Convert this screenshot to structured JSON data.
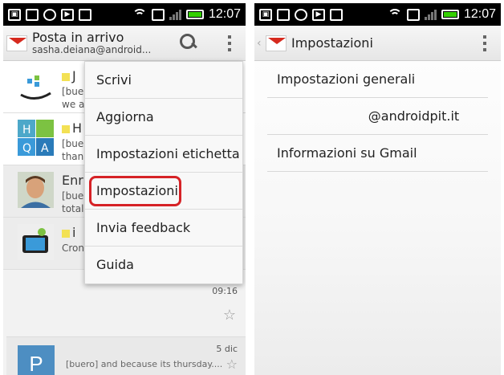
{
  "status_bar": {
    "time": "12:07",
    "icons_left": [
      "picture-icon",
      "bag-icon",
      "chrome-icon",
      "play-store-icon",
      "bag-icon"
    ],
    "icons_right": [
      "wifi-icon",
      "vibrate-icon",
      "signal-icon",
      "battery-icon"
    ]
  },
  "left": {
    "action_bar": {
      "title": "Posta in arrivo",
      "account": "sasha.deiana@android..."
    },
    "overflow_menu": {
      "items": [
        "Scrivi",
        "Aggiorna",
        "Impostazioni etichetta",
        "Impostazioni",
        "Invia feedback",
        "Guida"
      ],
      "highlighted_index": 3
    },
    "emails": [
      {
        "from": "J",
        "tag": "[bue",
        "snippet": "we a"
      },
      {
        "from": "H",
        "tag": "[bue",
        "snippet": "than"
      },
      {
        "from": "Enr",
        "tag": "[bue",
        "snippet": "total"
      },
      {
        "from": "i",
        "tag": "",
        "snippet": "Cron"
      }
    ],
    "time_label": "09:16",
    "last_email": {
      "avatar_letter": "P",
      "date": "5 dic",
      "snippet": "[buero] and because its thursday...."
    }
  },
  "right": {
    "action_bar": {
      "title": "Impostazioni"
    },
    "items": [
      "Impostazioni generali",
      "@androidpit.it",
      "Informazioni su Gmail"
    ]
  },
  "colors": {
    "highlight": "#d62226",
    "gmail_red": "#d62a1e",
    "battery": "#34d000",
    "avatar_p": "#4d8ec2"
  }
}
